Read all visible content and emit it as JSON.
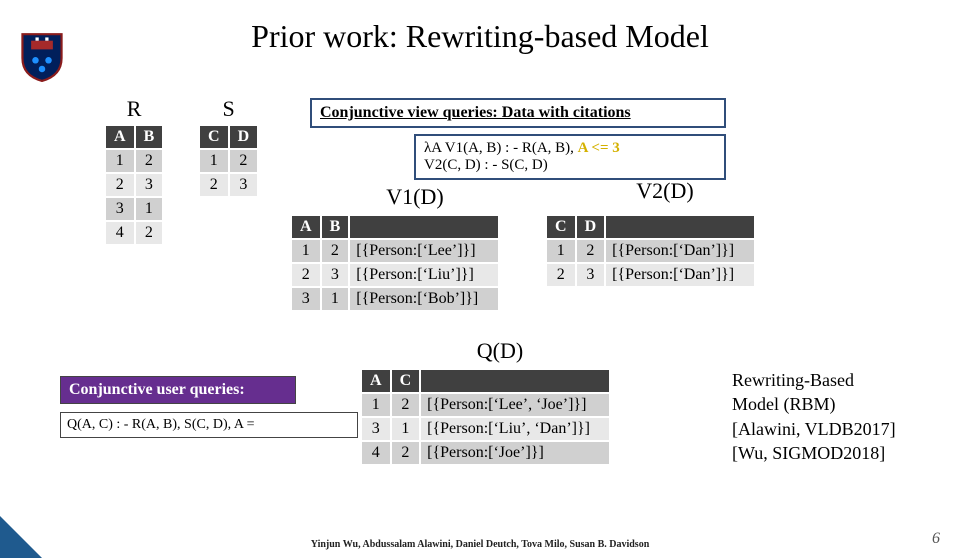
{
  "title": "Prior work: Rewriting-based Model",
  "slide_number": "6",
  "credits": "Yinjun Wu, Abdussalam Alawini, Daniel Deutch, Tova Milo, Susan B. Davidson",
  "relations": {
    "R": {
      "name": "R",
      "cols": [
        "A",
        "B"
      ],
      "rows": [
        [
          "1",
          "2"
        ],
        [
          "2",
          "3"
        ],
        [
          "3",
          "1"
        ],
        [
          "4",
          "2"
        ]
      ]
    },
    "S": {
      "name": "S",
      "cols": [
        "C",
        "D"
      ],
      "rows": [
        [
          "1",
          "2"
        ],
        [
          "2",
          "3"
        ]
      ]
    }
  },
  "view_header": "Conjunctive view queries: Data with citations",
  "view_defs": {
    "line1_pre": "λA V1(A, B) : - R(A, B), ",
    "line1_cond": "A <= 3",
    "line2": "V2(C, D) : - S(C, D)"
  },
  "views": {
    "V1": {
      "name": "V1(D)",
      "cols": [
        "A",
        "B",
        ""
      ],
      "rows": [
        [
          "1",
          "2",
          "[{Person:[‘Lee’]}]"
        ],
        [
          "2",
          "3",
          "[{Person:[‘Liu’]}]"
        ],
        [
          "3",
          "1",
          "[{Person:[‘Bob’]}]"
        ]
      ]
    },
    "V2": {
      "name": "V2(D)",
      "cols": [
        "C",
        "D",
        ""
      ],
      "rows": [
        [
          "1",
          "2",
          "[{Person:[‘Dan’]}]"
        ],
        [
          "2",
          "3",
          "[{Person:[‘Dan’]}]"
        ]
      ]
    }
  },
  "user_query": {
    "heading": "Conjunctive user queries:",
    "body": "Q(A, C) : - R(A, B), S(C, D), A ="
  },
  "Q": {
    "name": "Q(D)",
    "cols": [
      "A",
      "C",
      ""
    ],
    "rows": [
      [
        "1",
        "2",
        "[{Person:[‘Lee’, ‘Joe’]}]"
      ],
      [
        "3",
        "1",
        "[{Person:[‘Liu’, ‘Dan’]}]"
      ],
      [
        "4",
        "2",
        "[{Person:[‘Joe’]}]"
      ]
    ]
  },
  "refs": {
    "l1": "Rewriting-Based",
    "l2": "Model (RBM)",
    "l3": "[Alawini, VLDB2017]",
    "l4": "[Wu, SIGMOD2018]"
  }
}
